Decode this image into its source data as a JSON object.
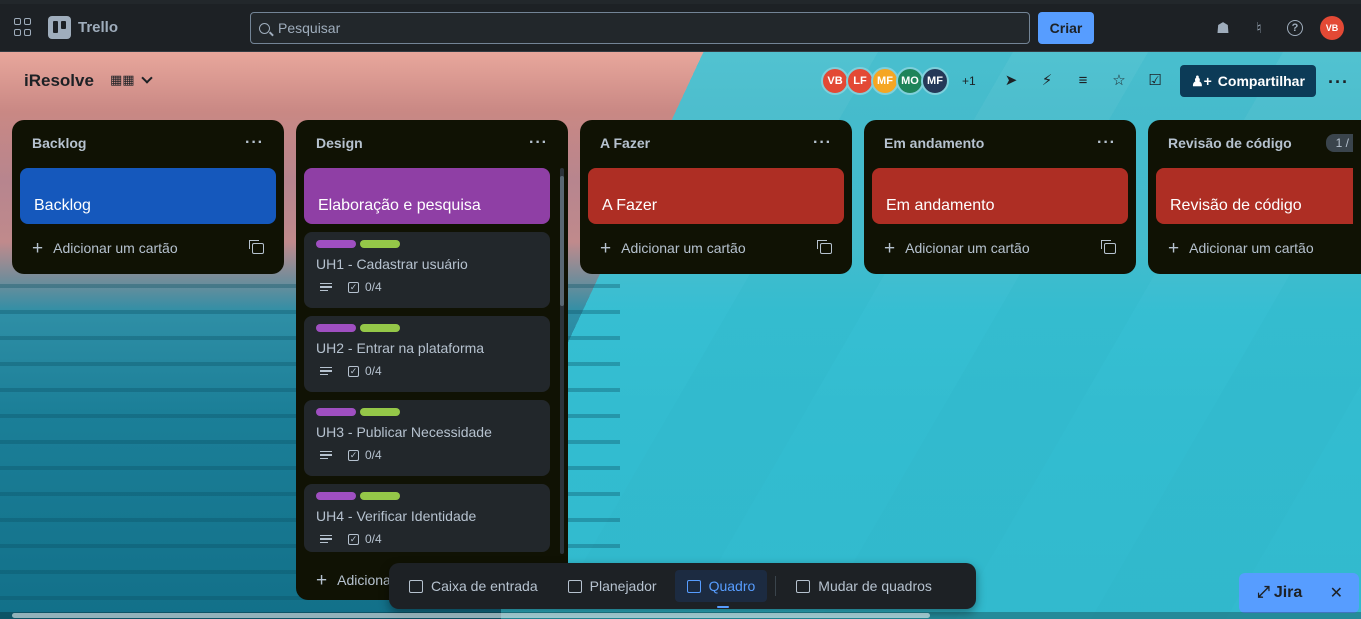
{
  "app": {
    "name": "Trello"
  },
  "search": {
    "placeholder": "Pesquisar"
  },
  "toolbar": {
    "create_label": "Criar",
    "user_initials": "VB"
  },
  "board": {
    "title": "iResolve",
    "members": [
      {
        "initials": "VB",
        "color": "#e34935"
      },
      {
        "initials": "LF",
        "color": "#e34935"
      },
      {
        "initials": "MF",
        "color": "#f5a623"
      },
      {
        "initials": "MO",
        "color": "#1f845a"
      },
      {
        "initials": "MF",
        "color": "#253858"
      }
    ],
    "more_members": "+1",
    "share_label": "Compartilhar"
  },
  "lists": [
    {
      "title": "Backlog",
      "cover": "Backlog",
      "cover_color": "#1558bc",
      "add_label": "Adicionar um cartão"
    },
    {
      "title": "Design",
      "cover": "Elaboração e pesquisa",
      "cover_color": "#8f3fa5",
      "add_label": "Adicionar um cartão",
      "cards": [
        {
          "title": "UH1 - Cadastrar usuário",
          "checklist": "0/4"
        },
        {
          "title": "UH2 - Entrar na plataforma",
          "checklist": "0/4"
        },
        {
          "title": "UH3 - Publicar Necessidade",
          "checklist": "0/4"
        },
        {
          "title": "UH4 - Verificar Identidade",
          "checklist": "0/4"
        }
      ],
      "add_label_truncated": "Adiciona"
    },
    {
      "title": "A Fazer",
      "cover": "A Fazer",
      "cover_color": "#ae2e24",
      "add_label": "Adicionar um cartão"
    },
    {
      "title": "Em andamento",
      "cover": "Em andamento",
      "cover_color": "#ae2e24",
      "add_label": "Adicionar um cartão"
    },
    {
      "title": "Revisão de código",
      "cover": "Revisão de código",
      "cover_color": "#ae2e24",
      "add_label": "Adicionar um cartão",
      "count_badge": "1 /"
    }
  ],
  "label_colors": {
    "purple": "#9f4fc1",
    "green": "#94c748"
  },
  "bottom_nav": {
    "inbox": "Caixa de entrada",
    "planner": "Planejador",
    "board": "Quadro",
    "switch": "Mudar de quadros"
  },
  "jira": {
    "label": "Jira"
  }
}
